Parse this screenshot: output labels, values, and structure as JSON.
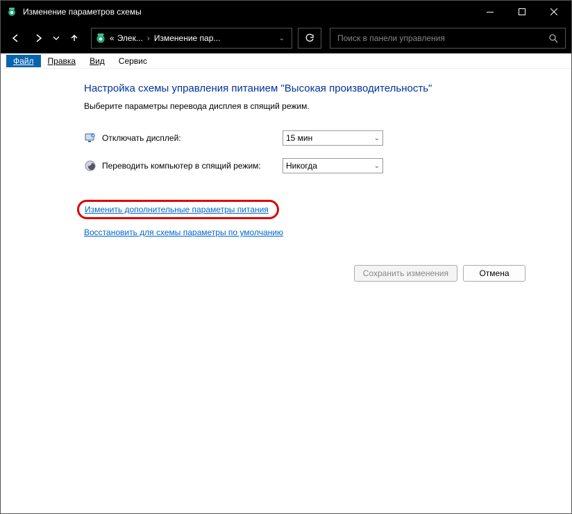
{
  "titlebar": {
    "title": "Изменение параметров схемы"
  },
  "breadcrumb": {
    "prefix": "«",
    "crumb1": "Элек...",
    "crumb2": "Изменение пар..."
  },
  "search": {
    "placeholder": "Поиск в панели управления"
  },
  "menu": {
    "file": "Файл",
    "edit": "Правка",
    "view": "Вид",
    "tools": "Сервис"
  },
  "content": {
    "heading": "Настройка схемы управления питанием \"Высокая производительность\"",
    "subtext": "Выберите параметры перевода дисплея в спящий режим.",
    "row1_label": "Отключать дисплей:",
    "row1_value": "15 мин",
    "row2_label": "Переводить компьютер в спящий режим:",
    "row2_value": "Никогда",
    "link_advanced": "Изменить дополнительные параметры питания",
    "link_restore": "Восстановить для схемы параметры по умолчанию",
    "btn_save": "Сохранить изменения",
    "btn_cancel": "Отмена"
  }
}
